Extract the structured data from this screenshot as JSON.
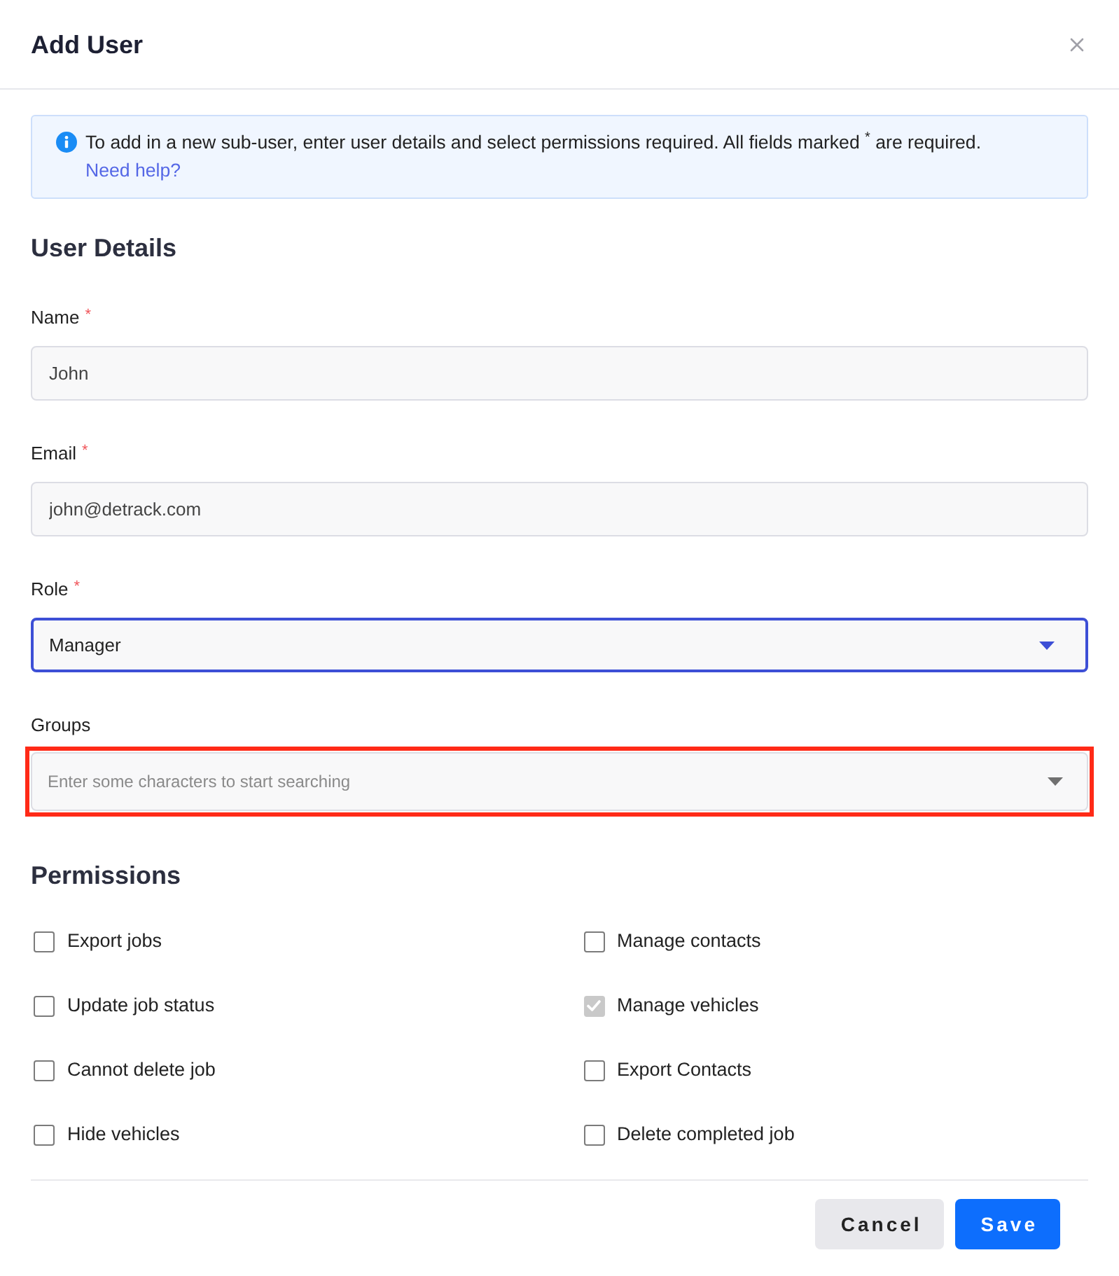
{
  "modal": {
    "title": "Add User"
  },
  "alert": {
    "text": "To add in a new sub-user, enter user details and select permissions required. All fields marked $^{*}$ are required.",
    "link": "Need help?"
  },
  "user_details": {
    "heading": "User Details",
    "fields": [
      {
        "kind": "input",
        "label": "Name",
        "required_mark": "*",
        "value": "John",
        "focused": false
      },
      {
        "kind": "input",
        "label": "Email",
        "required_mark": "*",
        "value": "john@detrack.com",
        "focused": false
      },
      {
        "kind": "select",
        "label": "Role",
        "required_mark": "*",
        "value": "Manager",
        "focused": true
      },
      {
        "kind": "search_select",
        "label": "Groups",
        "placeholder": "Enter some characters to start searching",
        "focused": false,
        "highlighted": true
      }
    ]
  },
  "permissions": {
    "heading": "Permissions",
    "items": [
      {
        "label": "Export jobs",
        "checked": false,
        "disabled": false
      },
      {
        "label": "Manage contacts",
        "checked": false,
        "disabled": false
      },
      {
        "label": "Update job status",
        "checked": false,
        "disabled": false
      },
      {
        "label": "Manage vehicles",
        "checked": true,
        "disabled": true
      },
      {
        "label": "Cannot delete job",
        "checked": false,
        "disabled": false
      },
      {
        "label": "Export Contacts",
        "checked": false,
        "disabled": false
      },
      {
        "label": "Hide vehicles",
        "checked": false,
        "disabled": false
      },
      {
        "label": "Delete completed job",
        "checked": false,
        "disabled": false
      }
    ]
  },
  "buttons": [
    {
      "label": "Cancel",
      "kind": "secondary"
    },
    {
      "label": "Save",
      "kind": "primary"
    }
  ]
}
